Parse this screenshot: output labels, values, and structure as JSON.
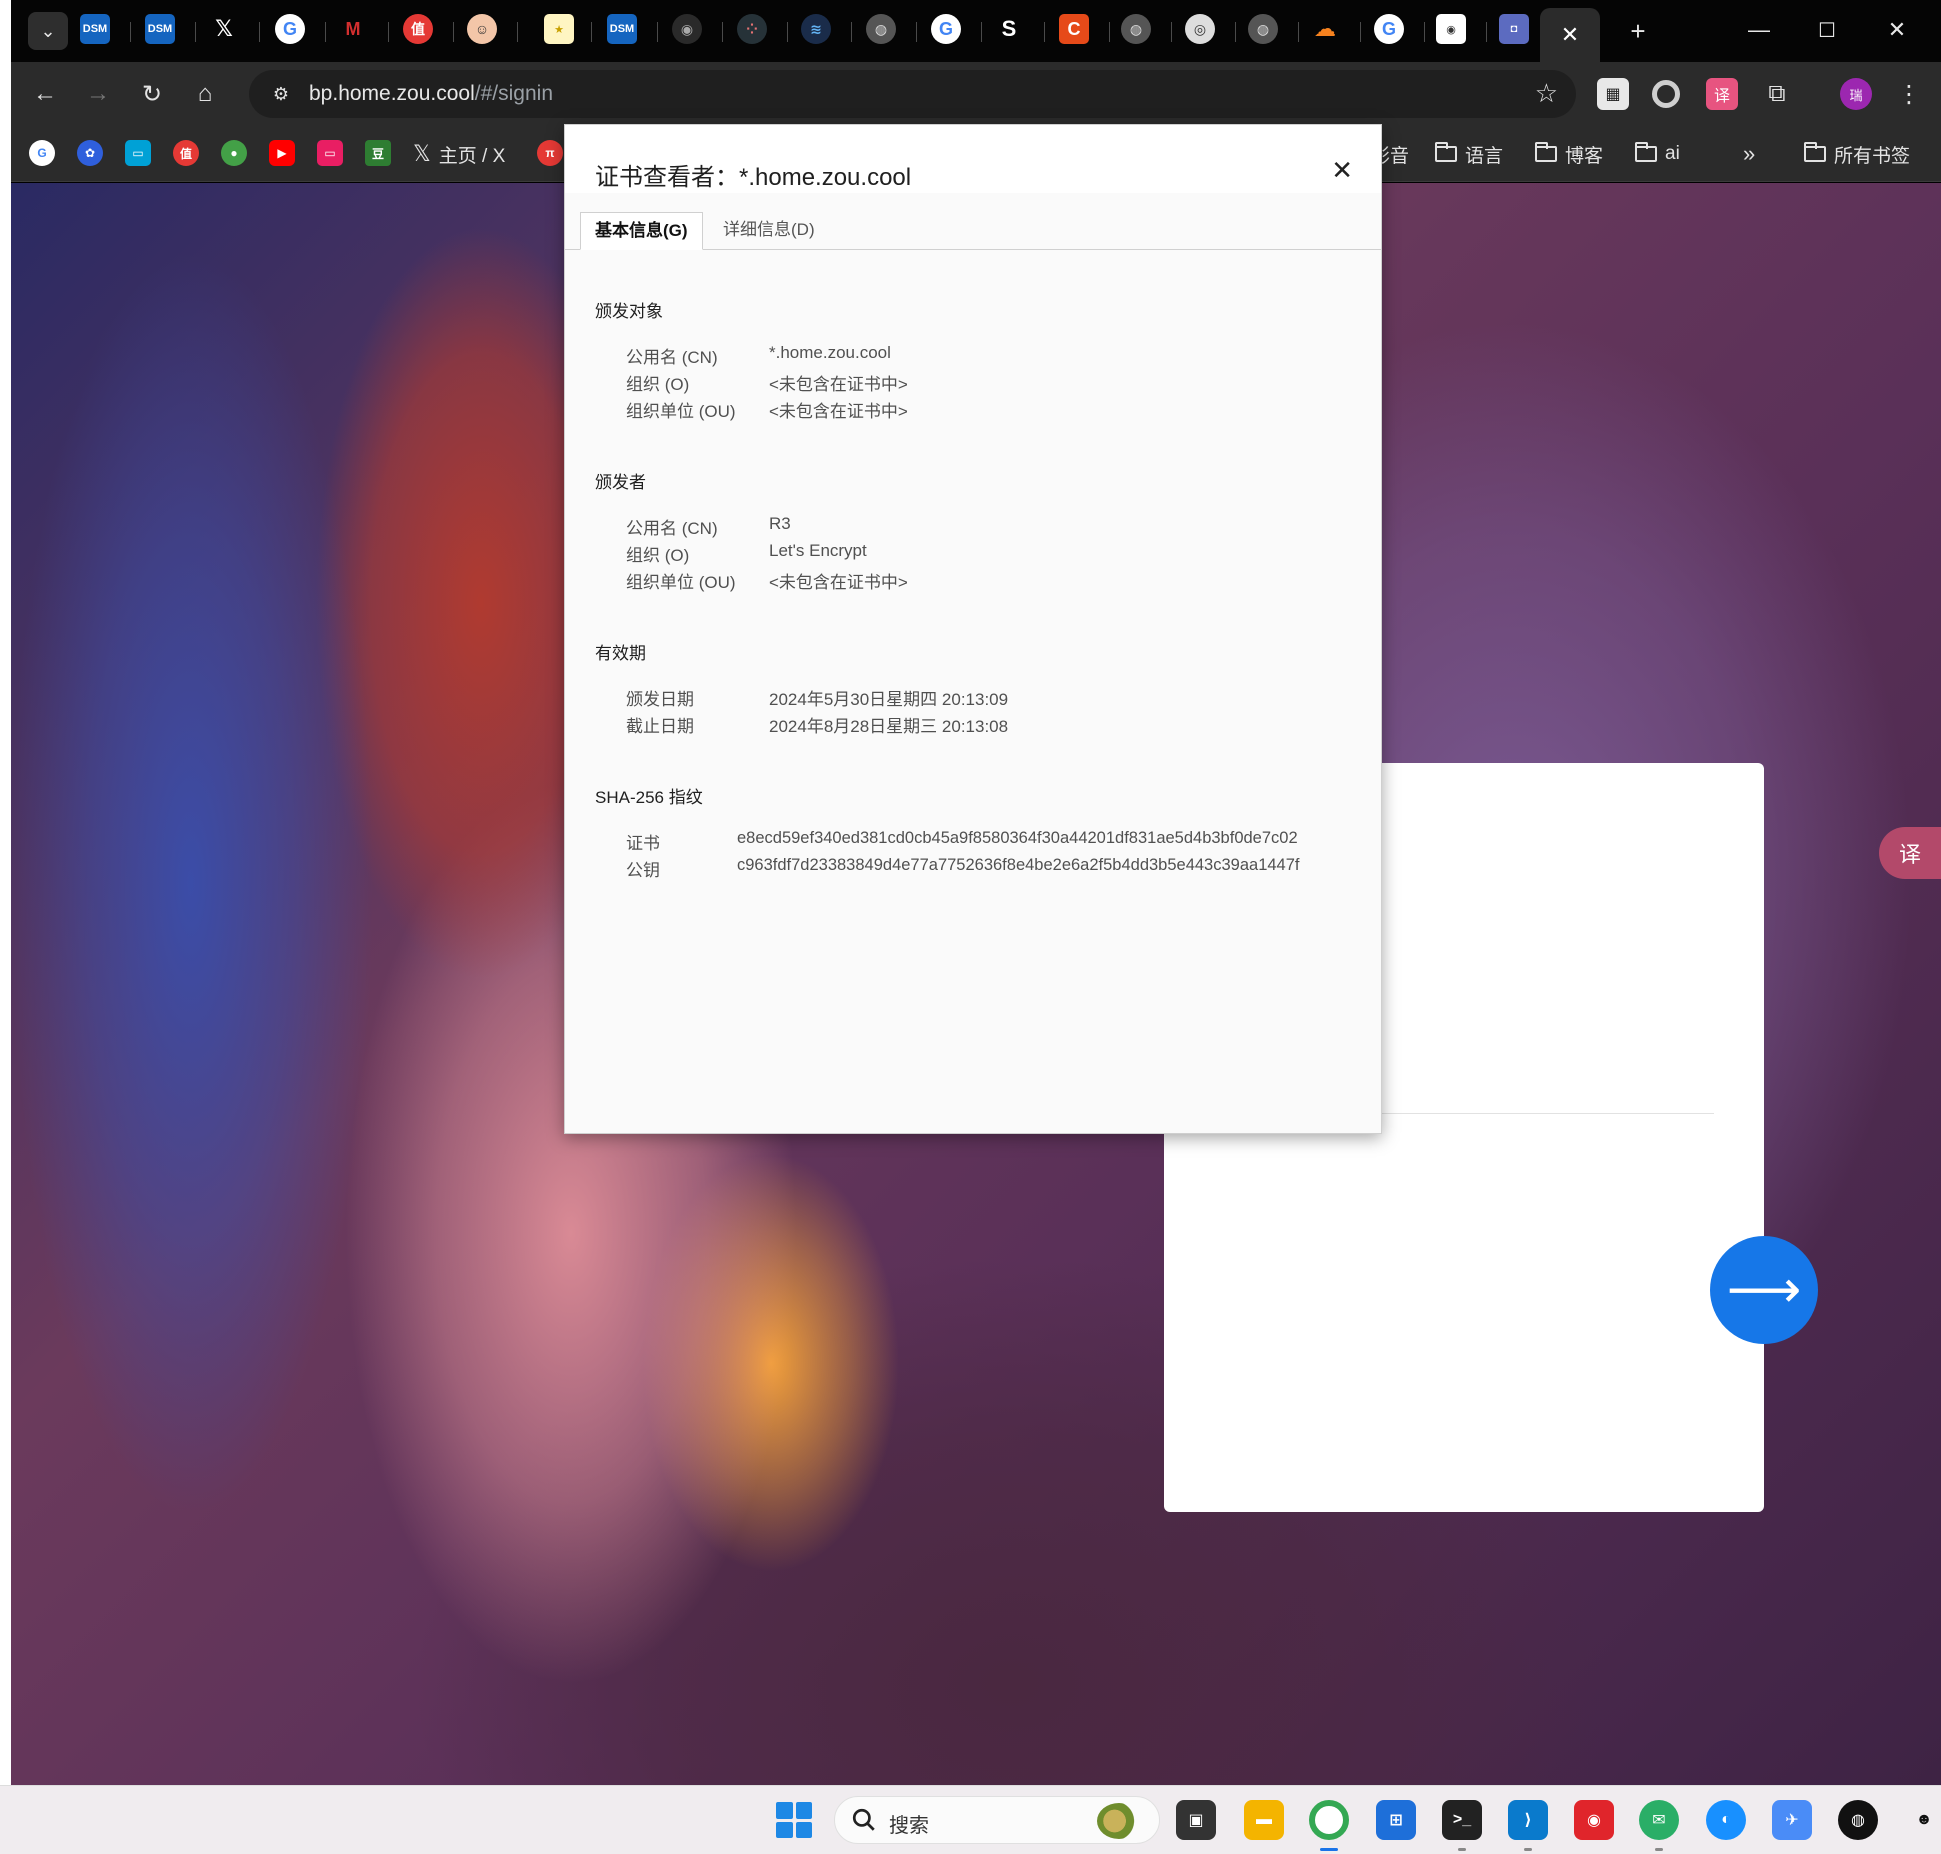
{
  "browser": {
    "address_bar": {
      "url_host": "bp.home.zou.cool",
      "url_path": "/#/signin"
    },
    "bookmarks_bar": {
      "x_label": "主页 / X",
      "folders": [
        "影音",
        "语言",
        "博客",
        "ai"
      ],
      "overflow": "»",
      "all_bookmarks": "所有书签"
    },
    "profile_initial": "瑞"
  },
  "cert_viewer": {
    "title": "证书查看者：*.home.zou.cool",
    "tabs": [
      "基本信息(G)",
      "详细信息(D)"
    ],
    "issued_to": {
      "heading": "颁发对象",
      "rows": [
        {
          "label": "公用名 (CN)",
          "value": "*.home.zou.cool"
        },
        {
          "label": "组织 (O)",
          "value": "<未包含在证书中>"
        },
        {
          "label": "组织单位 (OU)",
          "value": "<未包含在证书中>"
        }
      ]
    },
    "issued_by": {
      "heading": "颁发者",
      "rows": [
        {
          "label": "公用名 (CN)",
          "value": "R3"
        },
        {
          "label": "组织 (O)",
          "value": "Let's Encrypt"
        },
        {
          "label": "组织单位 (OU)",
          "value": "<未包含在证书中>"
        }
      ]
    },
    "validity": {
      "heading": "有效期",
      "rows": [
        {
          "label": "颁发日期",
          "value": "2024年5月30日星期四 20:13:09"
        },
        {
          "label": "截止日期",
          "value": "2024年8月28日星期三 20:13:08"
        }
      ]
    },
    "fingerprints": {
      "heading": "SHA-256 指纹",
      "rows": [
        {
          "label": "证书",
          "value": "e8ecd59ef340ed381cd0cb45a9f8580364f30a44201df831ae5d4b3bf0de7c02"
        },
        {
          "label": "公钥",
          "value": "c963fdf7d23383849d4e77a7752636f8e4be2e6a2f5b4dd3b5e443c39aa1447f"
        }
      ]
    }
  },
  "taskbar": {
    "search_placeholder": "搜索"
  },
  "icons": {
    "tab_favicons": [
      "dsm-icon",
      "dsm-icon",
      "x-icon",
      "google-icon",
      "gmail-icon",
      "zhide-icon",
      "avatar-icon",
      "trophy-icon",
      "dsm-icon",
      "github-icon",
      "dots-icon",
      "docker-icon",
      "globe-icon",
      "google-icon",
      "s-icon",
      "c-icon",
      "globe-icon",
      "chrome-icon",
      "globe-icon",
      "cloudflare-icon",
      "google-icon",
      "target-icon",
      "copilot-icon"
    ],
    "accent": "#1677e8"
  }
}
